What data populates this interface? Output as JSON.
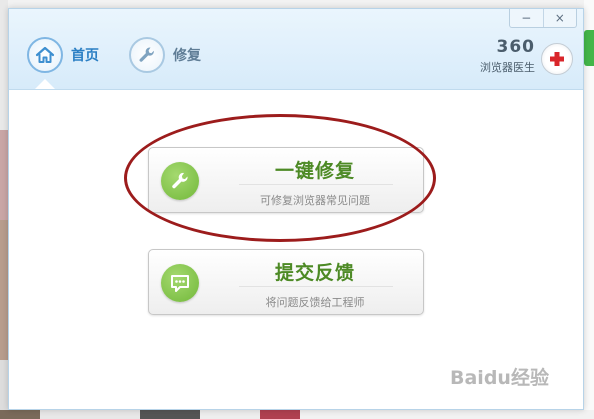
{
  "window": {
    "minimize_glyph": "−",
    "close_glyph": "×"
  },
  "tabs": [
    {
      "label": "首页",
      "icon": "home-icon",
      "active": true
    },
    {
      "label": "修复",
      "icon": "wrench-icon",
      "active": false
    }
  ],
  "brand": {
    "number": "360",
    "name": "浏览器医生",
    "logo_icon": "red-cross-icon"
  },
  "actions": [
    {
      "title": "一键修复",
      "subtitle": "可修复浏览器常见问题",
      "icon": "wrench-icon"
    },
    {
      "title": "提交反馈",
      "subtitle": "将问题反馈给工程师",
      "icon": "chat-bubble-icon"
    }
  ],
  "watermark": {
    "text": "Baidu经验"
  },
  "colors": {
    "accent_blue": "#2b7fc4",
    "action_green": "#4d8a25",
    "highlight_red": "#9c1c1c",
    "brand_red": "#d9262b"
  }
}
